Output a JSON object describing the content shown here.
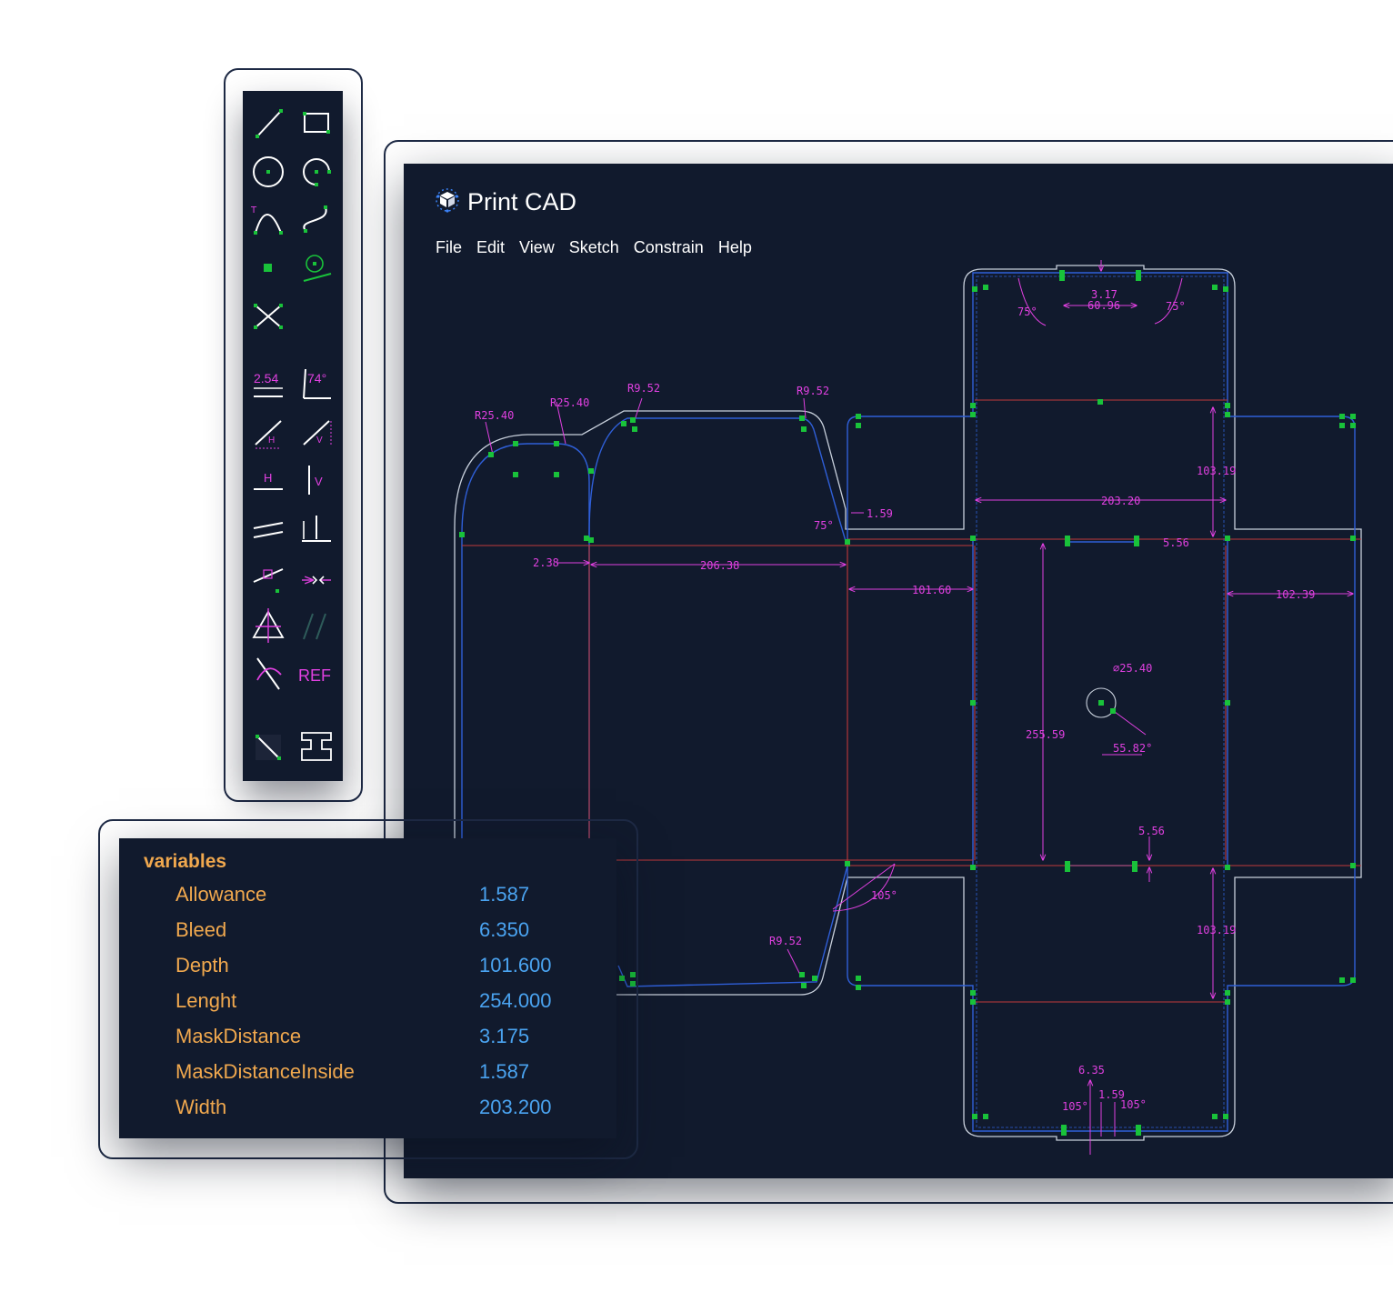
{
  "app": {
    "title": "Print CAD",
    "logo_icon": "cube-logo-icon"
  },
  "menu": [
    {
      "label": "File"
    },
    {
      "label": "Edit"
    },
    {
      "label": "View"
    },
    {
      "label": "Sketch"
    },
    {
      "label": "Constrain"
    },
    {
      "label": "Help"
    }
  ],
  "tools": [
    {
      "icon": "line-tool-icon"
    },
    {
      "icon": "rectangle-tool-icon"
    },
    {
      "icon": "circle-tool-icon"
    },
    {
      "icon": "arc-tool-icon"
    },
    {
      "icon": "conic-tool-icon"
    },
    {
      "icon": "spline-tool-icon"
    },
    {
      "icon": "point-tool-icon"
    },
    {
      "icon": "tangent-circle-tool-icon"
    },
    {
      "icon": "trim-tool-icon"
    },
    {
      "icon": "distance-constraint-icon",
      "label": "2.54"
    },
    {
      "icon": "angle-constraint-icon",
      "label": "74°"
    },
    {
      "icon": "horizontal-distance-icon",
      "label": "H"
    },
    {
      "icon": "vertical-distance-icon",
      "label": "V"
    },
    {
      "icon": "horizontal-constraint-icon",
      "label": "H"
    },
    {
      "icon": "vertical-constraint-icon",
      "label": "V"
    },
    {
      "icon": "parallel-constraint-icon"
    },
    {
      "icon": "perpendicular-constraint-icon"
    },
    {
      "icon": "point-on-line-constraint-icon"
    },
    {
      "icon": "coincident-constraint-icon"
    },
    {
      "icon": "symmetric-constraint-icon"
    },
    {
      "icon": "same-orientation-icon"
    },
    {
      "icon": "tangent-constraint-icon"
    },
    {
      "icon": "reference-toggle-icon",
      "label": "REF"
    },
    {
      "icon": "construction-toggle-icon"
    },
    {
      "icon": "section-tool-icon"
    }
  ],
  "variables": {
    "heading": "variables",
    "items": [
      {
        "name": "Allowance",
        "value": "1.587"
      },
      {
        "name": "Bleed",
        "value": "6.350"
      },
      {
        "name": "Depth",
        "value": "101.600"
      },
      {
        "name": "Lenght",
        "value": "254.000"
      },
      {
        "name": "MaskDistance",
        "value": "3.175"
      },
      {
        "name": "MaskDistanceInside",
        "value": "1.587"
      },
      {
        "name": "Width",
        "value": "203.200"
      }
    ]
  },
  "dimensions": {
    "r1": "R25.40",
    "r2": "R25.40",
    "r3": "R9.52",
    "r4": "R9.52",
    "r5": "R9.52",
    "d_238": "2.38",
    "d_20638": "206.38",
    "d_159": "1.59",
    "a_75_side": "75°",
    "d_10160": "101.60",
    "d_10239": "102.39",
    "d_10319a": "103.19",
    "d_20320": "203.20",
    "d_556a": "5.56",
    "d_556b": "5.56",
    "d_25559": "255.59",
    "d_2540dia": "⌀25.40",
    "a_5582": "55.82°",
    "a_105_side": "105°",
    "d_10319b": "103.19",
    "d_317": "3.17",
    "d_6096": "60.96",
    "a_75_top_left": "75°",
    "a_75_top_right": "75°",
    "d_635": "6.35",
    "d_159b": "1.59",
    "a_105_bl": "105°",
    "a_105_br": "105°"
  },
  "colors": {
    "background": "#111a2d",
    "outline": "#c8d0dc",
    "blue_line": "#2f5fd8",
    "red_line": "#c0393b",
    "dimension": "#e040e0",
    "point": "#19c23a",
    "variable_name": "#f0a84e",
    "variable_value": "#4aa3f0"
  }
}
